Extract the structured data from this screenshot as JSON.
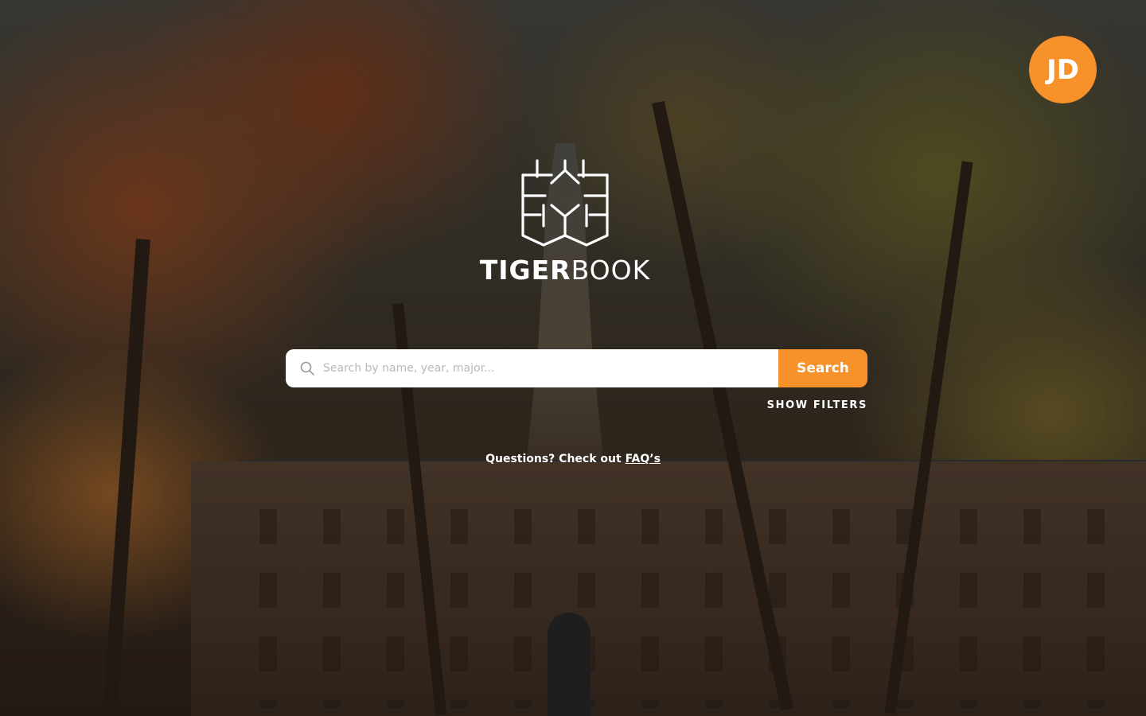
{
  "user": {
    "initials": "JD"
  },
  "brand": {
    "word_bold": "TIGER",
    "word_light": "BOOK"
  },
  "search": {
    "placeholder": "Search by name, year, major...",
    "button_label": "Search",
    "show_filters_label": "SHOW FILTERS"
  },
  "help": {
    "prefix": "Questions? Check out ",
    "link_label": "FAQ’s"
  },
  "colors": {
    "accent": "#f7922a",
    "text": "#ffffff",
    "input_bg": "#ffffff"
  },
  "icons": {
    "search": "search-icon",
    "logo": "tigerbook-logo-icon"
  }
}
